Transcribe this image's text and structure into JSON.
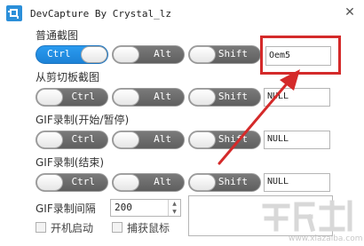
{
  "window": {
    "title": "DevCapture By Crystal_lz",
    "close_glyph": "✕"
  },
  "sections": [
    {
      "label": "普通截图",
      "ctrl": {
        "label": "Ctrl",
        "state": "on"
      },
      "alt": {
        "label": "Alt",
        "state": "off"
      },
      "shift": {
        "label": "Shift",
        "state": "off"
      },
      "key": "Oem5"
    },
    {
      "label": "从剪切板截图",
      "ctrl": {
        "label": "Ctrl",
        "state": "off"
      },
      "alt": {
        "label": "Alt",
        "state": "off"
      },
      "shift": {
        "label": "Shift",
        "state": "off"
      },
      "key": "NULL"
    },
    {
      "label": "GIF录制(开始/暂停)",
      "ctrl": {
        "label": "Ctrl",
        "state": "off"
      },
      "alt": {
        "label": "Alt",
        "state": "off"
      },
      "shift": {
        "label": "Shift",
        "state": "off"
      },
      "key": "NULL"
    },
    {
      "label": "GIF录制(结束)",
      "ctrl": {
        "label": "Ctrl",
        "state": "off"
      },
      "alt": {
        "label": "Alt",
        "state": "off"
      },
      "shift": {
        "label": "Shift",
        "state": "off"
      },
      "key": "NULL"
    }
  ],
  "gif_interval": {
    "label": "GIF录制间隔",
    "value": "200"
  },
  "options": {
    "autostart_label": "开机启动",
    "capture_cursor_label": "捕获鼠标"
  },
  "spinner": {
    "up_glyph": "▲",
    "down_glyph": "▼"
  },
  "watermark": {
    "site": "www.xiazaiba.com"
  },
  "colors": {
    "accent": "#1c82d6",
    "highlight": "#d42a2a",
    "arrow": "#d42a2a",
    "toggle_off": "#6a6a6a"
  },
  "icons": {
    "app": "capture-frame-icon",
    "close": "close-icon"
  }
}
